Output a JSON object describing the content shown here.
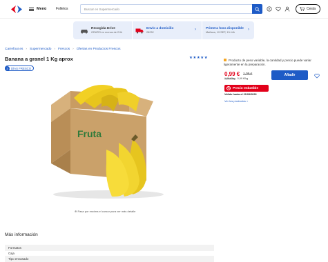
{
  "header": {
    "menu_label": "Menú",
    "folletos_label": "Folletos",
    "search_placeholder": "Buscar en Supermercado",
    "cart_label": "Cesta"
  },
  "banner": {
    "items": [
      {
        "title": "Recogida Drive",
        "subtitle": "GRATIS en menos de 2Hh"
      },
      {
        "title": "Envío a domicilio",
        "subtitle": "28232"
      },
      {
        "title": "Primera hora disponible",
        "subtitle": "Mañana, 19 SEP, 13-14h"
      }
    ]
  },
  "breadcrumb": [
    "Carrefour.es",
    "Supermercado",
    "Frescos",
    "Ofertas en Productos Frescos"
  ],
  "product": {
    "title": "Banana a granel 1 Kg aprox",
    "fresh_days": "3",
    "fresh_label": "DÍAS FRESCO",
    "rating_stars": "★★★★★",
    "box_text": "Fruta",
    "zoom_hint": "Pasa por encima el cursor para ver más detalle"
  },
  "purchase": {
    "weight_notice": "Producto de peso variable, la cantidad y precio puede variar ligeramente en la preparación.",
    "price": "0,99 €",
    "old_price": "1,09 €",
    "unit_old": "1,09 €/kg",
    "unit_new": "0,99 €/kg",
    "add_label": "Añadir",
    "promo_label": "Precio Imbatible",
    "promo_icon": "%",
    "valid_until": "Válido hasta el 21/09/2026",
    "see_products": "Ver los productos >"
  },
  "more_info": {
    "title": "Más información",
    "rows": [
      {
        "kind": "head",
        "text": "Formatos"
      },
      {
        "kind": "cell",
        "text": "Caja"
      },
      {
        "kind": "head",
        "text": "Tipo envasado"
      }
    ]
  },
  "colors": {
    "brand_blue": "#1e5bc6",
    "promo_red": "#e2001a"
  }
}
